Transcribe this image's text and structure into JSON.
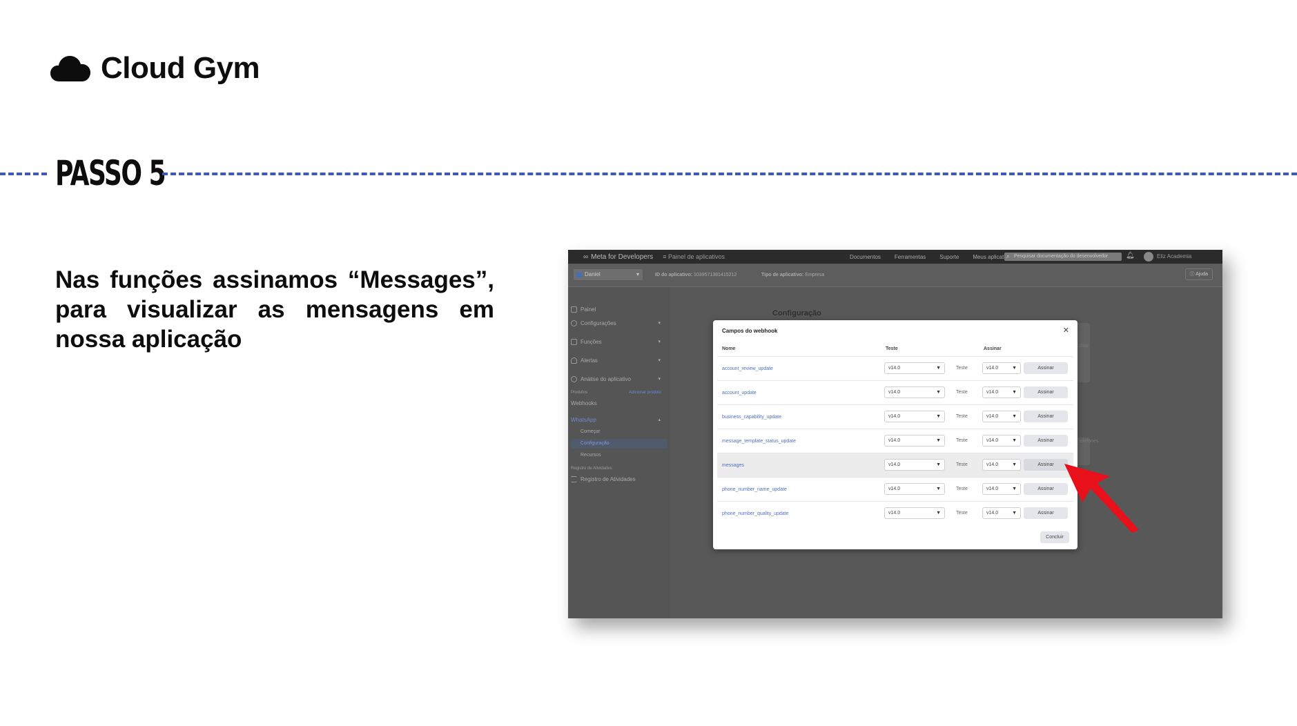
{
  "brand": {
    "name": "Cloud Gym",
    "logo_icon": "cloud-icon"
  },
  "step": {
    "title": "PASSO 5",
    "line_color": "#3f5ab0"
  },
  "description": "Nas funções assinamos “Messages”, para visualizar as mensagens em nossa aplicação",
  "screenshot": {
    "topbar": {
      "logo": "Meta for Developers",
      "panel": "Painel de aplicativos",
      "nav": [
        "Documentos",
        "Ferramentas",
        "Suporte",
        "Meus aplicativos"
      ],
      "search_placeholder": "Pesquisar documentação do desenvolvedor",
      "user": "Eliz Academia"
    },
    "subbar": {
      "app_name": "Daniel",
      "app_id_label": "ID do aplicativo:",
      "app_id": "1039571381415212",
      "app_type_label": "Tipo de aplicativo:",
      "app_type": "Empresa",
      "help": "Ajuda"
    },
    "sidebar": {
      "items": [
        "Painel",
        "Configurações",
        "Funções",
        "Alertas",
        "Análise do aplicativo"
      ],
      "products_label": "Produtos",
      "add_product": "Adicionar produto",
      "webhooks": "Webhooks",
      "whatsapp": "WhatsApp",
      "whatsapp_sub": [
        "Começar",
        "Configuração",
        "Recursos"
      ],
      "activity_label": "Registro de Atividades",
      "activity_item": "Registro de Atividades"
    },
    "page_title": "Configuração",
    "background_labels": {
      "edit": "Editar",
      "phones": "telefones"
    },
    "modal": {
      "title": "Campos do webhook",
      "columns": {
        "name": "Nome",
        "test": "Teste",
        "subscribe": "Assinar"
      },
      "rows": [
        {
          "name": "account_review_update",
          "version_test": "v14.0",
          "test": "Teste",
          "version_sub": "v14.0",
          "action": "Assinar"
        },
        {
          "name": "account_update",
          "version_test": "v14.0",
          "test": "Teste",
          "version_sub": "v14.0",
          "action": "Assinar"
        },
        {
          "name": "business_capability_update",
          "version_test": "v14.0",
          "test": "Teste",
          "version_sub": "v14.0",
          "action": "Assinar"
        },
        {
          "name": "message_template_status_update",
          "version_test": "v14.0",
          "test": "Teste",
          "version_sub": "v14.0",
          "action": "Assinar"
        },
        {
          "name": "messages",
          "version_test": "v14.0",
          "test": "Teste",
          "version_sub": "v14.0",
          "action": "Assinar"
        },
        {
          "name": "phone_number_name_update",
          "version_test": "v14.0",
          "test": "Teste",
          "version_sub": "v14.0",
          "action": "Assinar"
        },
        {
          "name": "phone_number_quality_update",
          "version_test": "v14.0",
          "test": "Teste",
          "version_sub": "v14.0",
          "action": "Assinar"
        }
      ],
      "done": "Concluir"
    }
  },
  "annotation": {
    "pointer_icon": "red-arrow-icon",
    "color": "#e8101a"
  }
}
